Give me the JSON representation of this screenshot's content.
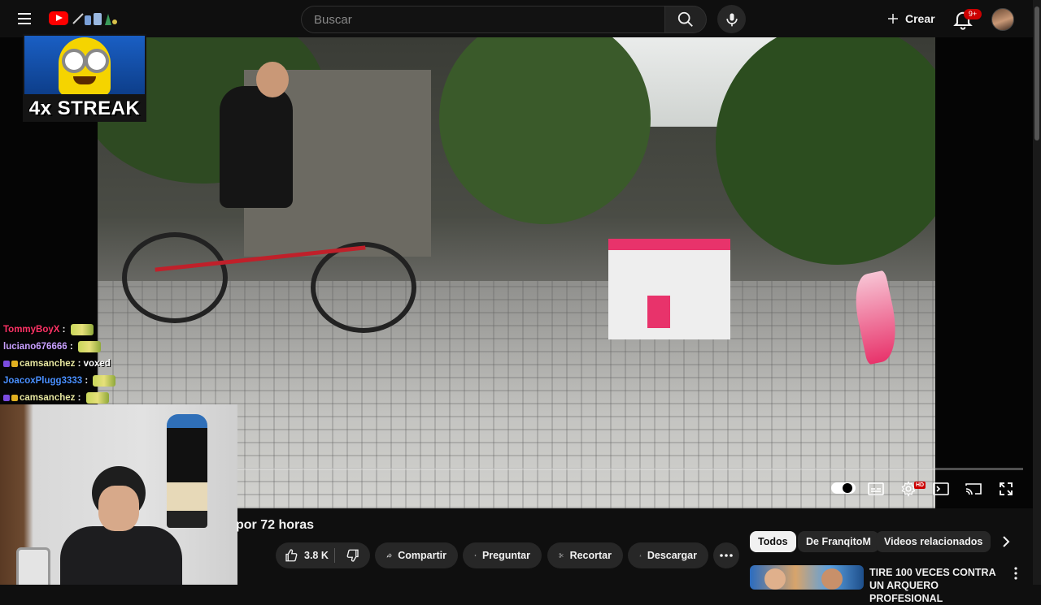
{
  "header": {
    "search_placeholder": "Buscar",
    "create_label": "Crear",
    "notifications_badge": "9+"
  },
  "overlay": {
    "streak_text": "4x STREAK",
    "chat": [
      {
        "user": "TommyBoyX",
        "color": "#ff3366",
        "msg": "",
        "emote": true
      },
      {
        "user": "luciano676666",
        "color": "#c9a0ff",
        "msg": "",
        "emote": true
      },
      {
        "user": "camsanchez",
        "color": "#e6e6a0",
        "msg": "voxed",
        "emote": false,
        "badges": true
      },
      {
        "user": "JoacoxPlugg3333",
        "color": "#4a90ff",
        "msg": "",
        "emote": true
      },
      {
        "user": "camsanchez",
        "color": "#e6e6a0",
        "msg": "",
        "emote": true,
        "badges": true
      }
    ]
  },
  "video": {
    "title_visible": "por 72 horas",
    "like_count": "3.8 K",
    "share_label": "Compartir",
    "ask_label": "Preguntar",
    "clip_label": "Recortar",
    "download_label": "Descargar"
  },
  "chips": [
    "Todos",
    "De FranqitoM",
    "Videos relacionados"
  ],
  "recommendation": {
    "title": "TIRE 100 VECES CONTRA UN ARQUERO PROFESIONAL"
  },
  "colors": {
    "background": "#0f0f0f",
    "accent": "#ff0000",
    "pill": "#272727"
  }
}
